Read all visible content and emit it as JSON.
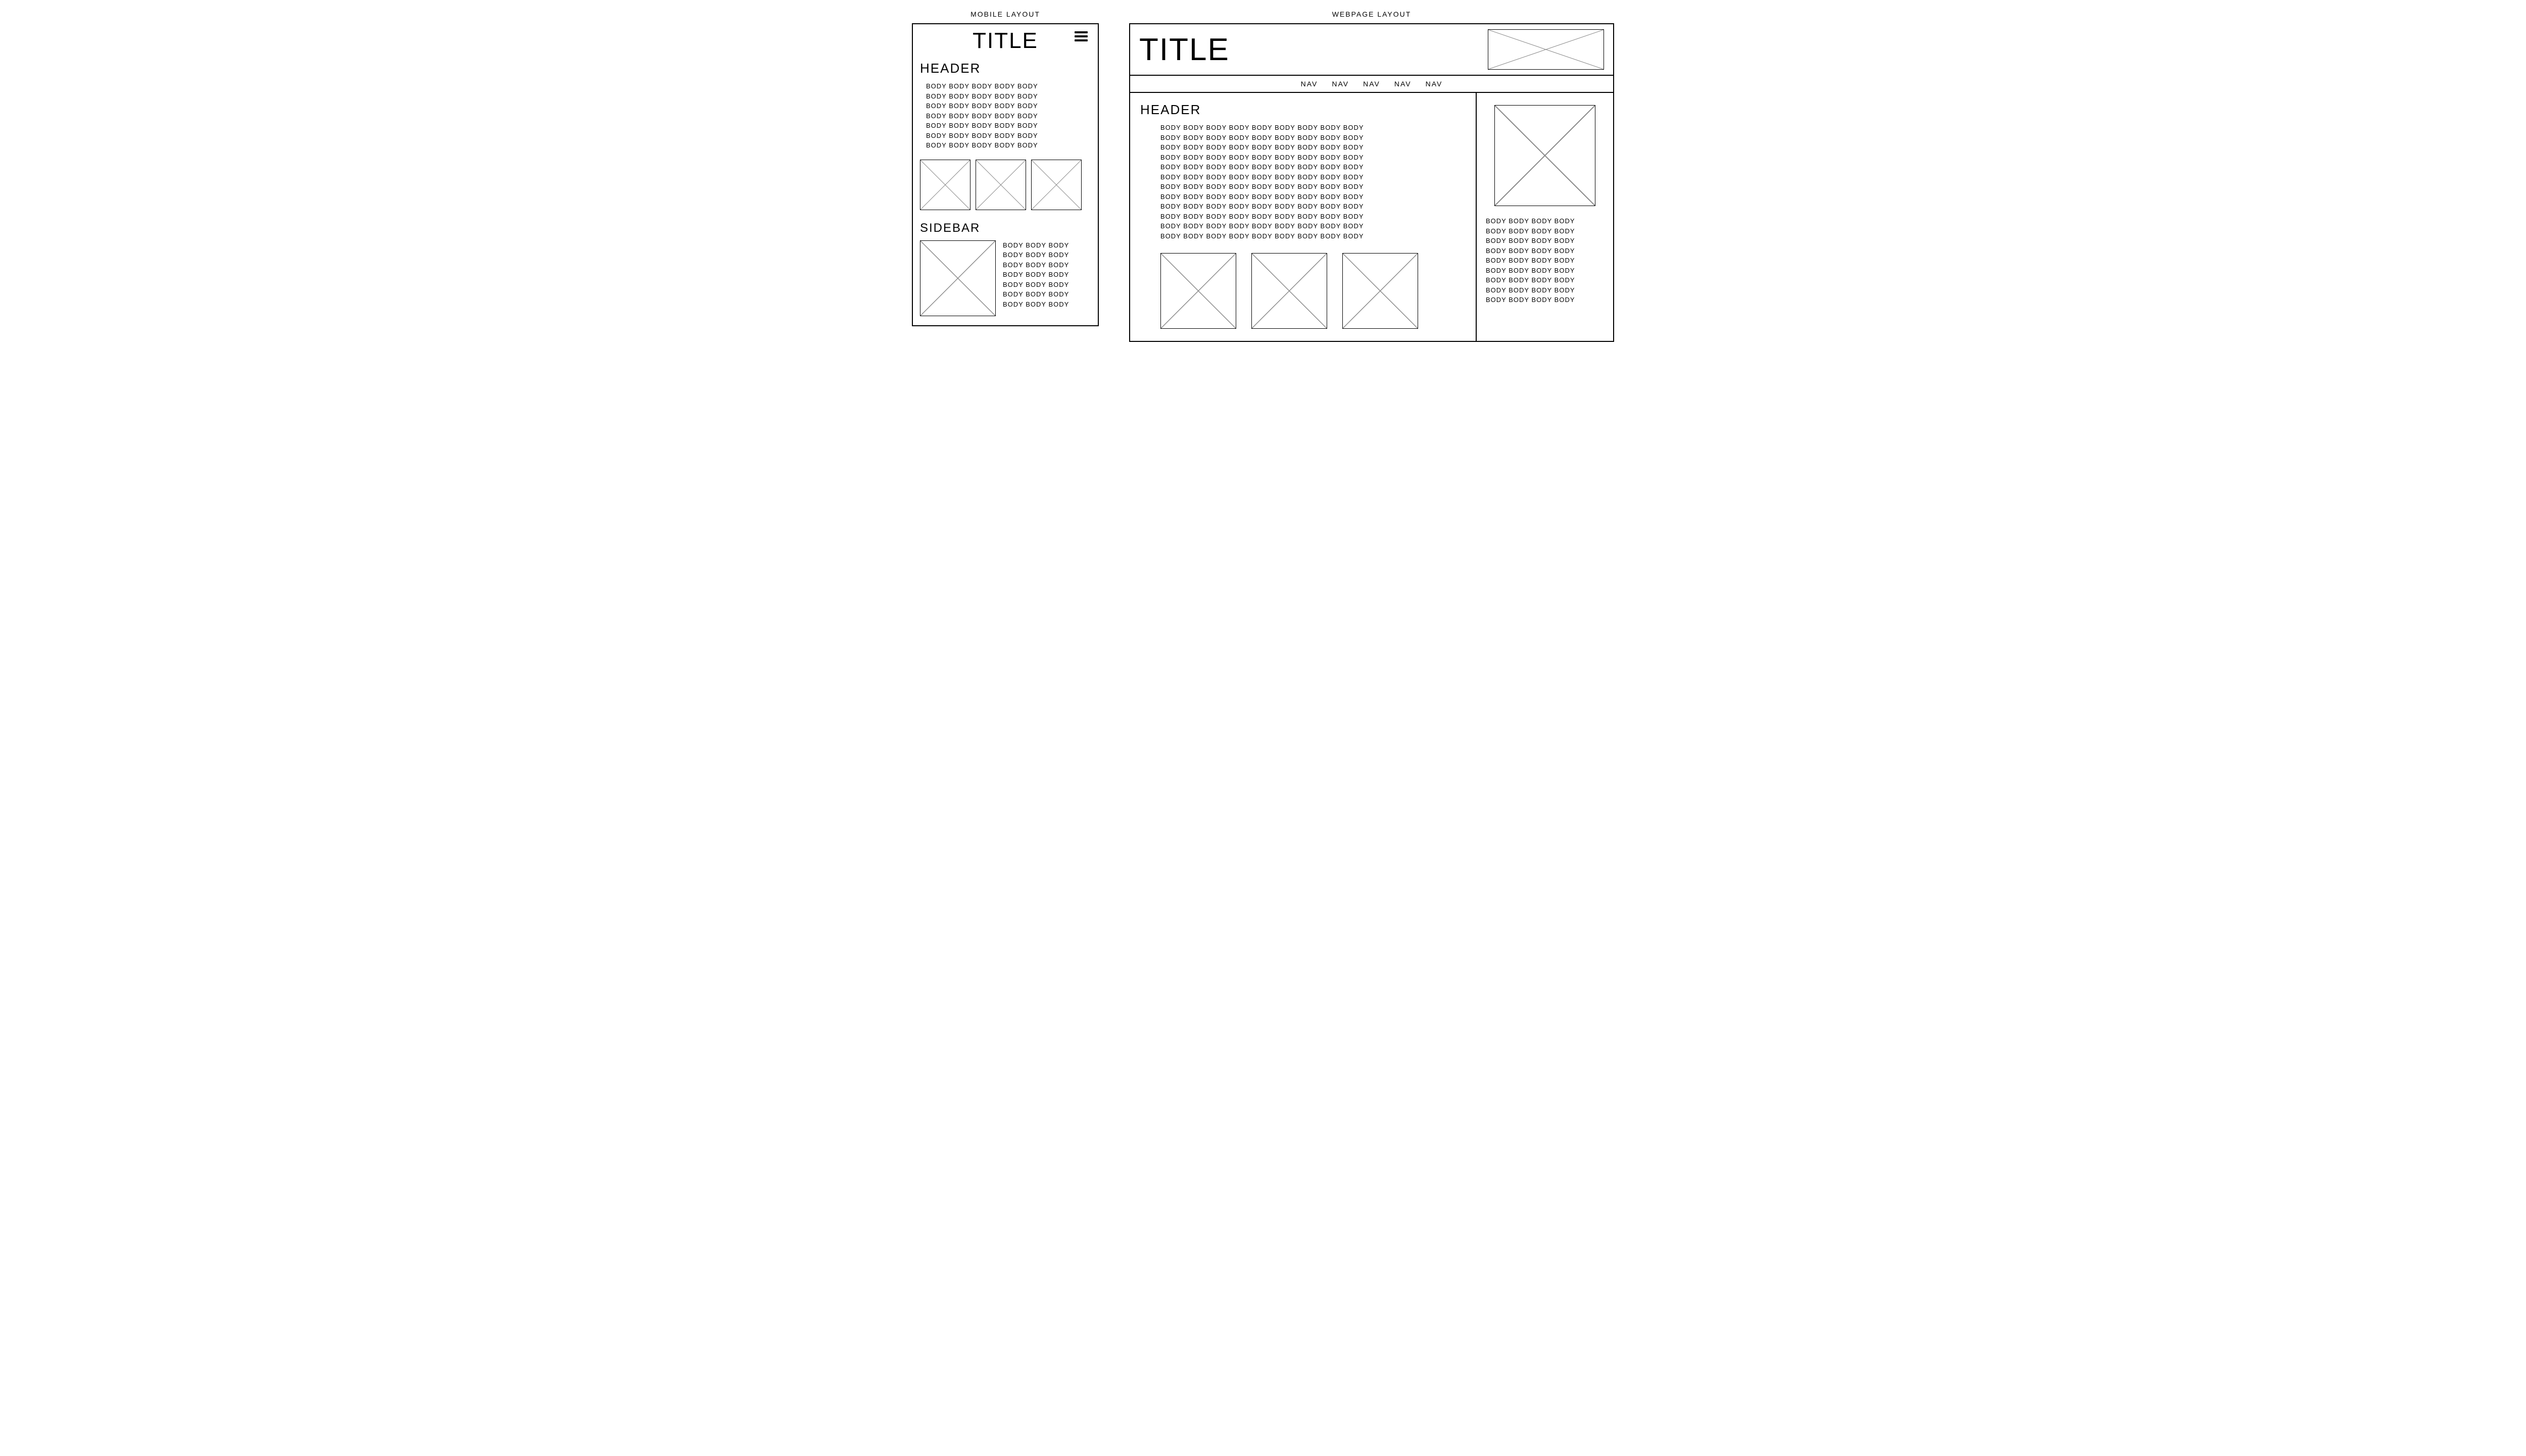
{
  "mobile": {
    "label": "MOBILE LAYOUT",
    "title": "TITLE",
    "header": "HEADER",
    "body": "BODY BODY BODY BODY BODY\nBODY BODY BODY BODY BODY\nBODY BODY BODY BODY BODY\nBODY BODY BODY BODY BODY\nBODY BODY BODY BODY BODY\nBODY BODY BODY BODY BODY\nBODY BODY BODY BODY BODY",
    "sidebar_header": "SIDEBAR",
    "sidebar_body": "BODY BODY BODY\nBODY BODY BODY\nBODY BODY BODY\nBODY BODY BODY\nBODY BODY BODY\nBODY BODY BODY\nBODY BODY BODY"
  },
  "web": {
    "label": "WEBPAGE LAYOUT",
    "title": "TITLE",
    "nav": [
      "NAV",
      "NAV",
      "NAV",
      "NAV",
      "NAV"
    ],
    "header": "HEADER",
    "body": "BODY BODY BODY BODY BODY BODY BODY BODY BODY\nBODY BODY BODY BODY BODY BODY BODY BODY BODY\nBODY BODY BODY BODY BODY BODY BODY BODY BODY\nBODY BODY BODY BODY BODY BODY BODY BODY BODY\nBODY BODY BODY BODY BODY BODY BODY BODY BODY\nBODY BODY BODY BODY BODY BODY BODY BODY BODY\nBODY BODY BODY BODY BODY BODY BODY BODY BODY\nBODY BODY BODY BODY BODY BODY BODY BODY BODY\nBODY BODY BODY BODY BODY BODY BODY BODY BODY\nBODY BODY BODY BODY BODY BODY BODY BODY BODY\nBODY BODY BODY BODY BODY BODY BODY BODY BODY\nBODY BODY BODY BODY BODY BODY BODY BODY BODY",
    "side_body": "BODY BODY BODY BODY\nBODY BODY BODY BODY\nBODY BODY BODY BODY\nBODY BODY BODY BODY\nBODY BODY BODY BODY\nBODY BODY BODY BODY\nBODY BODY BODY BODY\nBODY BODY BODY BODY\nBODY BODY BODY BODY"
  }
}
